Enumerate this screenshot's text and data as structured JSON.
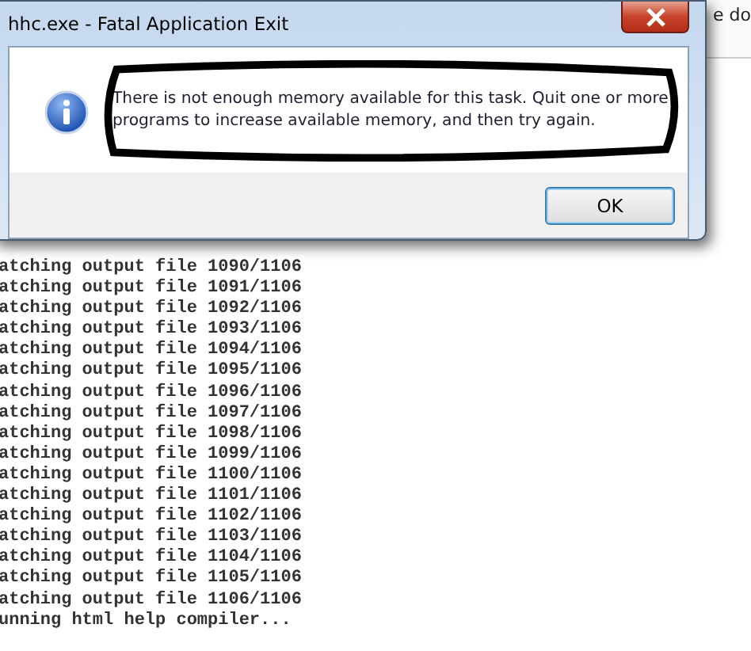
{
  "background_window": {
    "title_fragment": "e do"
  },
  "dialog": {
    "title": "hhc.exe - Fatal Application Exit",
    "message": "There is not enough memory available for this task. Quit one or more programs to increase available memory, and then try again.",
    "buttons": [
      {
        "label": "OK",
        "selected": true
      }
    ]
  },
  "console": {
    "lines": [
      "atching output file 1090/1106",
      "atching output file 1091/1106",
      "atching output file 1092/1106",
      "atching output file 1093/1106",
      "atching output file 1094/1106",
      "atching output file 1095/1106",
      "atching output file 1096/1106",
      "atching output file 1097/1106",
      "atching output file 1098/1106",
      "atching output file 1099/1106",
      "atching output file 1100/1106",
      "atching output file 1101/1106",
      "atching output file 1102/1106",
      "atching output file 1103/1106",
      "atching output file 1104/1106",
      "atching output file 1105/1106",
      "atching output file 1106/1106",
      "unning html help compiler..."
    ]
  }
}
